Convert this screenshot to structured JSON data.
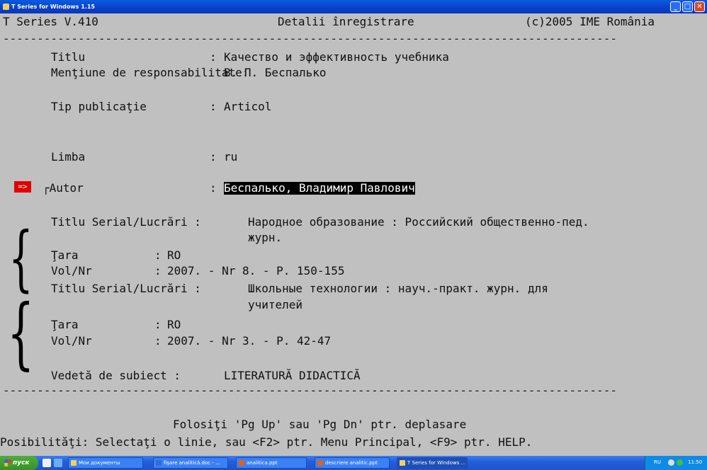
{
  "window": {
    "title": "T Series for Windows 1.15",
    "min_glyph": "_",
    "max_glyph": "□",
    "close_glyph": "✕"
  },
  "header": {
    "left": "T Series V.410",
    "center": "Detalii înregistrare",
    "right": "(c)2005 IME România"
  },
  "separator": "------------------------------------------------------------------------------------------",
  "record": {
    "titlu": {
      "label": "Titlu",
      "sep": ":",
      "value": "Качество и эффективность учебника"
    },
    "responsabilitate": {
      "label": "Menţiune de responsabilitate:",
      "value": "В. П. Беспалько"
    },
    "tip": {
      "label": "Tip publicaţie",
      "sep": ":",
      "value": "Articol"
    },
    "limba": {
      "label": "Limba",
      "sep": ":",
      "value": "ru"
    },
    "autor": {
      "marker": "=>",
      "label": "┌Autor",
      "sep": ":",
      "value": "Беспалько, Владимир Павлович"
    },
    "serial1": {
      "label": "Titlu Serial/Lucrări :",
      "value_line1": "Народное образование : Российский общественно-пед.",
      "value_line2": "журн.",
      "tara_label": "Ţara",
      "tara_sep": ":",
      "tara_value": "RO",
      "vol_label": "Vol/Nr",
      "vol_sep": ":",
      "vol_value": "2007. - Nr 8. - P. 150-155"
    },
    "serial2": {
      "label": "Titlu Serial/Lucrări :",
      "value_line1": "Школьные технологии : науч.-практ. журн. для",
      "value_line2": "учителей",
      "tara_label": "Ţara",
      "tara_sep": ":",
      "tara_value": "RO",
      "vol_label": "Vol/Nr",
      "vol_sep": ":",
      "vol_value": "2007. - Nr 3. - P. 42-47"
    },
    "subiect": {
      "label": "Vedetă de subiect :",
      "value": "LITERATURĂ DIDACTICĂ"
    }
  },
  "footer": {
    "hint": "Folosiţi 'Pg Up' sau 'Pg Dn' ptr. deplasare",
    "options": "Posibilităţi: Selectaţi o linie, sau <F2> ptr. Menu Principal, <F9> ptr. HELP."
  },
  "taskbar": {
    "start_label": "пуск",
    "tasks": [
      {
        "label": "Мои документы",
        "icon_color": "#f0d060"
      },
      {
        "label": "fişare analitică.doc - ...",
        "icon_color": "#2c6ce0"
      },
      {
        "label": "analitica.ppt",
        "icon_color": "#e06020"
      },
      {
        "label": "descriere analitic.ppt",
        "icon_color": "#e06020"
      },
      {
        "label": "T Series for Windows ...",
        "icon_color": "#f0d060"
      }
    ],
    "language": "RU",
    "clock": "11:50"
  }
}
